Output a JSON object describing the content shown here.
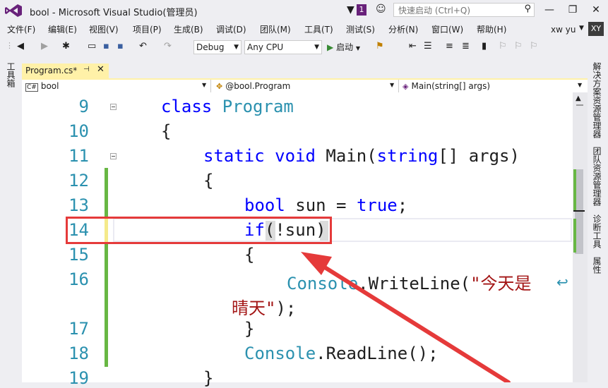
{
  "window": {
    "title": "bool - Microsoft Visual Studio(管理员)",
    "notification_count": "1",
    "quick_launch_placeholder": "快速启动 (Ctrl+Q)",
    "minimize": "—",
    "restore": "❐",
    "close": "✕"
  },
  "menu": {
    "items": [
      "文件(F)",
      "编辑(E)",
      "视图(V)",
      "项目(P)",
      "生成(B)",
      "调试(D)",
      "团队(M)",
      "工具(T)",
      "测试(S)",
      "分析(N)",
      "窗口(W)",
      "帮助(H)"
    ],
    "user_name": "xw yu",
    "avatar_initials": "XY"
  },
  "toolbar": {
    "configuration": "Debug",
    "platform": "Any CPU",
    "start_label": "启动"
  },
  "side_tabs": {
    "left": "工具箱",
    "right": [
      "解决方案资源管理器",
      "团队资源管理器",
      "诊断工具",
      "属性"
    ]
  },
  "document_tab": {
    "label": "Program.cs*",
    "pin": "⊣",
    "close": "✕"
  },
  "navigation_bar": {
    "project": "bool",
    "class": "@bool.Program",
    "member": "Main(string[] args)"
  },
  "editor": {
    "line_numbers": [
      "9",
      "10",
      "11",
      "12",
      "13",
      "14",
      "15",
      "16",
      "17",
      "18",
      "19"
    ],
    "lines": {
      "l9_kw": "class",
      "l9_type": "Program",
      "l10": "{",
      "l11_kw1": "static",
      "l11_kw2": "void",
      "l11_name": "Main(",
      "l11_kw3": "string",
      "l11_rest": "[] args)",
      "l12": "{",
      "l13_kw": "bool",
      "l13_mid": " sun = ",
      "l13_kw2": "true",
      "l13_end": ";",
      "l14_kw": "if",
      "l14_rest": "(!sun)",
      "l15": "{",
      "l16_type": "Console",
      "l16_call": ".WriteLine(",
      "l16_str": "\"今天是",
      "l16b_str": "晴天\"",
      "l16b_end": ");",
      "l17": "}",
      "l18_type": "Console",
      "l18_call": ".ReadLine();",
      "l19": "}"
    }
  },
  "colors": {
    "accent_tab": "#fff1a8",
    "annotation_red": "#e53a3a",
    "keyword_blue": "#0000ff",
    "type_teal": "#2b91af",
    "string_red": "#a31515",
    "change_green": "#68b744"
  },
  "icons": [
    "vs-logo-icon",
    "filter-icon",
    "feedback-icon",
    "search-icon",
    "play-icon",
    "wrap-icon"
  ]
}
